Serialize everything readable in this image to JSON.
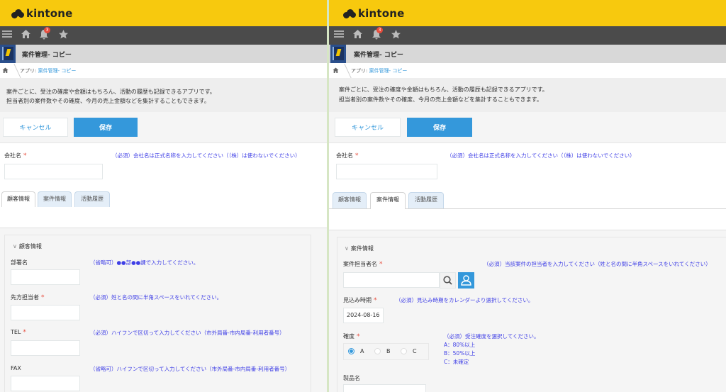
{
  "brand": {
    "name": "kintone"
  },
  "nav": {
    "badge": "3"
  },
  "app": {
    "name": "案件管理- コピー",
    "crumb_prefix": "アプリ:",
    "crumb_app": "案件管理- コピー",
    "desc_line1": "案件ごとに、受注の確度や金額はもちろん、活動の履歴も記録できるアプリです。",
    "desc_line2": "担当者別の案件数やその確度、今月の売上金額などを集計することもできます。"
  },
  "actions": {
    "cancel": "キャンセル",
    "save": "保存"
  },
  "company": {
    "label": "会社名",
    "req": "*",
    "hint": "（必須）会社名は正式名称を入力してください（（株）は使わないでください）",
    "value": ""
  },
  "tabs": [
    "顧客情報",
    "案件情報",
    "活動履歴"
  ],
  "left": {
    "group_title": "顧客情報",
    "fields": [
      {
        "label": "部署名",
        "req": "",
        "hint": "（省略可）●●部●●課で入力してください。",
        "value": ""
      },
      {
        "label": "先方担当者",
        "req": "*",
        "hint": "（必須）姓と名の間に半角スペースをいれてください。",
        "value": ""
      },
      {
        "label": "TEL",
        "req": "*",
        "hint": "（必須）ハイフンで区切って入力してください（市外局番-市内局番-利用者番号）",
        "value": ""
      },
      {
        "label": "FAX",
        "req": "",
        "hint": "（省略可）ハイフンで区切って入力してください（市外局番-市内局番-利用者番号）",
        "value": ""
      }
    ]
  },
  "right": {
    "group_title": "案件情報",
    "owner": {
      "label": "案件担当者名",
      "req": "*",
      "hint": "（必須）当該案件の担当者を入力してください（姓と名の間に半角スペースをいれてください）",
      "value": ""
    },
    "date": {
      "label": "見込み時期",
      "req": "*",
      "hint": "（必須）見込み時期をカレンダーより選択してください。",
      "value": "2024-08-16"
    },
    "prob": {
      "label": "確度",
      "req": "*",
      "hint": "（必須）受注確度を選択してください。",
      "hint_lines": [
        "A：80%以上",
        "B：50%以上",
        "C：未確定"
      ],
      "options": [
        "A",
        "B",
        "C"
      ],
      "selected": "A"
    },
    "product": {
      "label": "製品名"
    }
  },
  "colors": {
    "brand": "#f7c90e",
    "accent": "#3498db",
    "required": "#e74c3c",
    "hint": "#3f3fe6"
  },
  "icons": [
    "menu-icon",
    "home-icon",
    "bell-icon",
    "star-icon",
    "search-icon",
    "user-icon",
    "chevron-down-icon"
  ]
}
